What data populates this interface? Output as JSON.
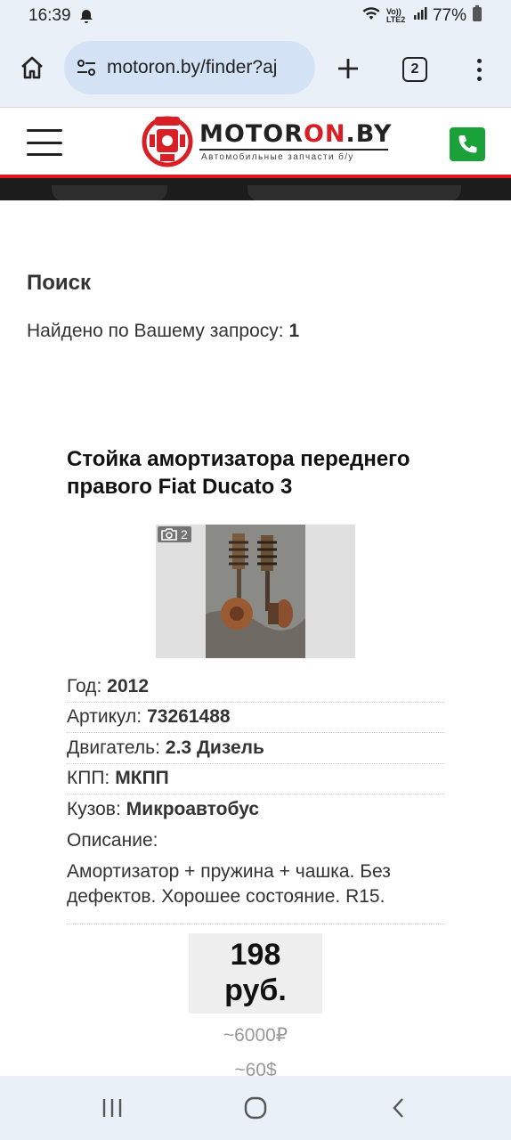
{
  "status_bar": {
    "time": "16:39",
    "network": "Vo)) LTE2",
    "battery": "77%"
  },
  "browser": {
    "url": "motoron.by/finder?aj",
    "tab_count": "2"
  },
  "site": {
    "brand_part1": "MOTOR",
    "brand_part2": "ON",
    "brand_part3": ".BY",
    "tagline": "Автомобильные запчасти б/у",
    "brand_color": "#d81f26",
    "phone_color": "#1aa13a"
  },
  "search": {
    "title": "Поиск",
    "found_label": "Найдено по Вашему запросу:",
    "found_count": "1"
  },
  "product": {
    "title": "Стойка амортизатора переднего правого Fiat Ducato 3",
    "photo_count": "2",
    "specs": [
      {
        "label": "Год:",
        "value": "2012"
      },
      {
        "label": "Артикул:",
        "value": "73261488"
      },
      {
        "label": "Двигатель:",
        "value": "2.3 Дизель"
      },
      {
        "label": "КПП:",
        "value": "МКПП"
      },
      {
        "label": "Кузов:",
        "value": "Микроавтобус"
      }
    ],
    "description_label": "Описание:",
    "description": "Амортизатор + пружина + чашка. Без дефектов. Хорошее состояние. R15.",
    "price_amount": "198",
    "price_unit": "руб.",
    "price_rub": "~6000₽",
    "price_usd": "~60$"
  }
}
